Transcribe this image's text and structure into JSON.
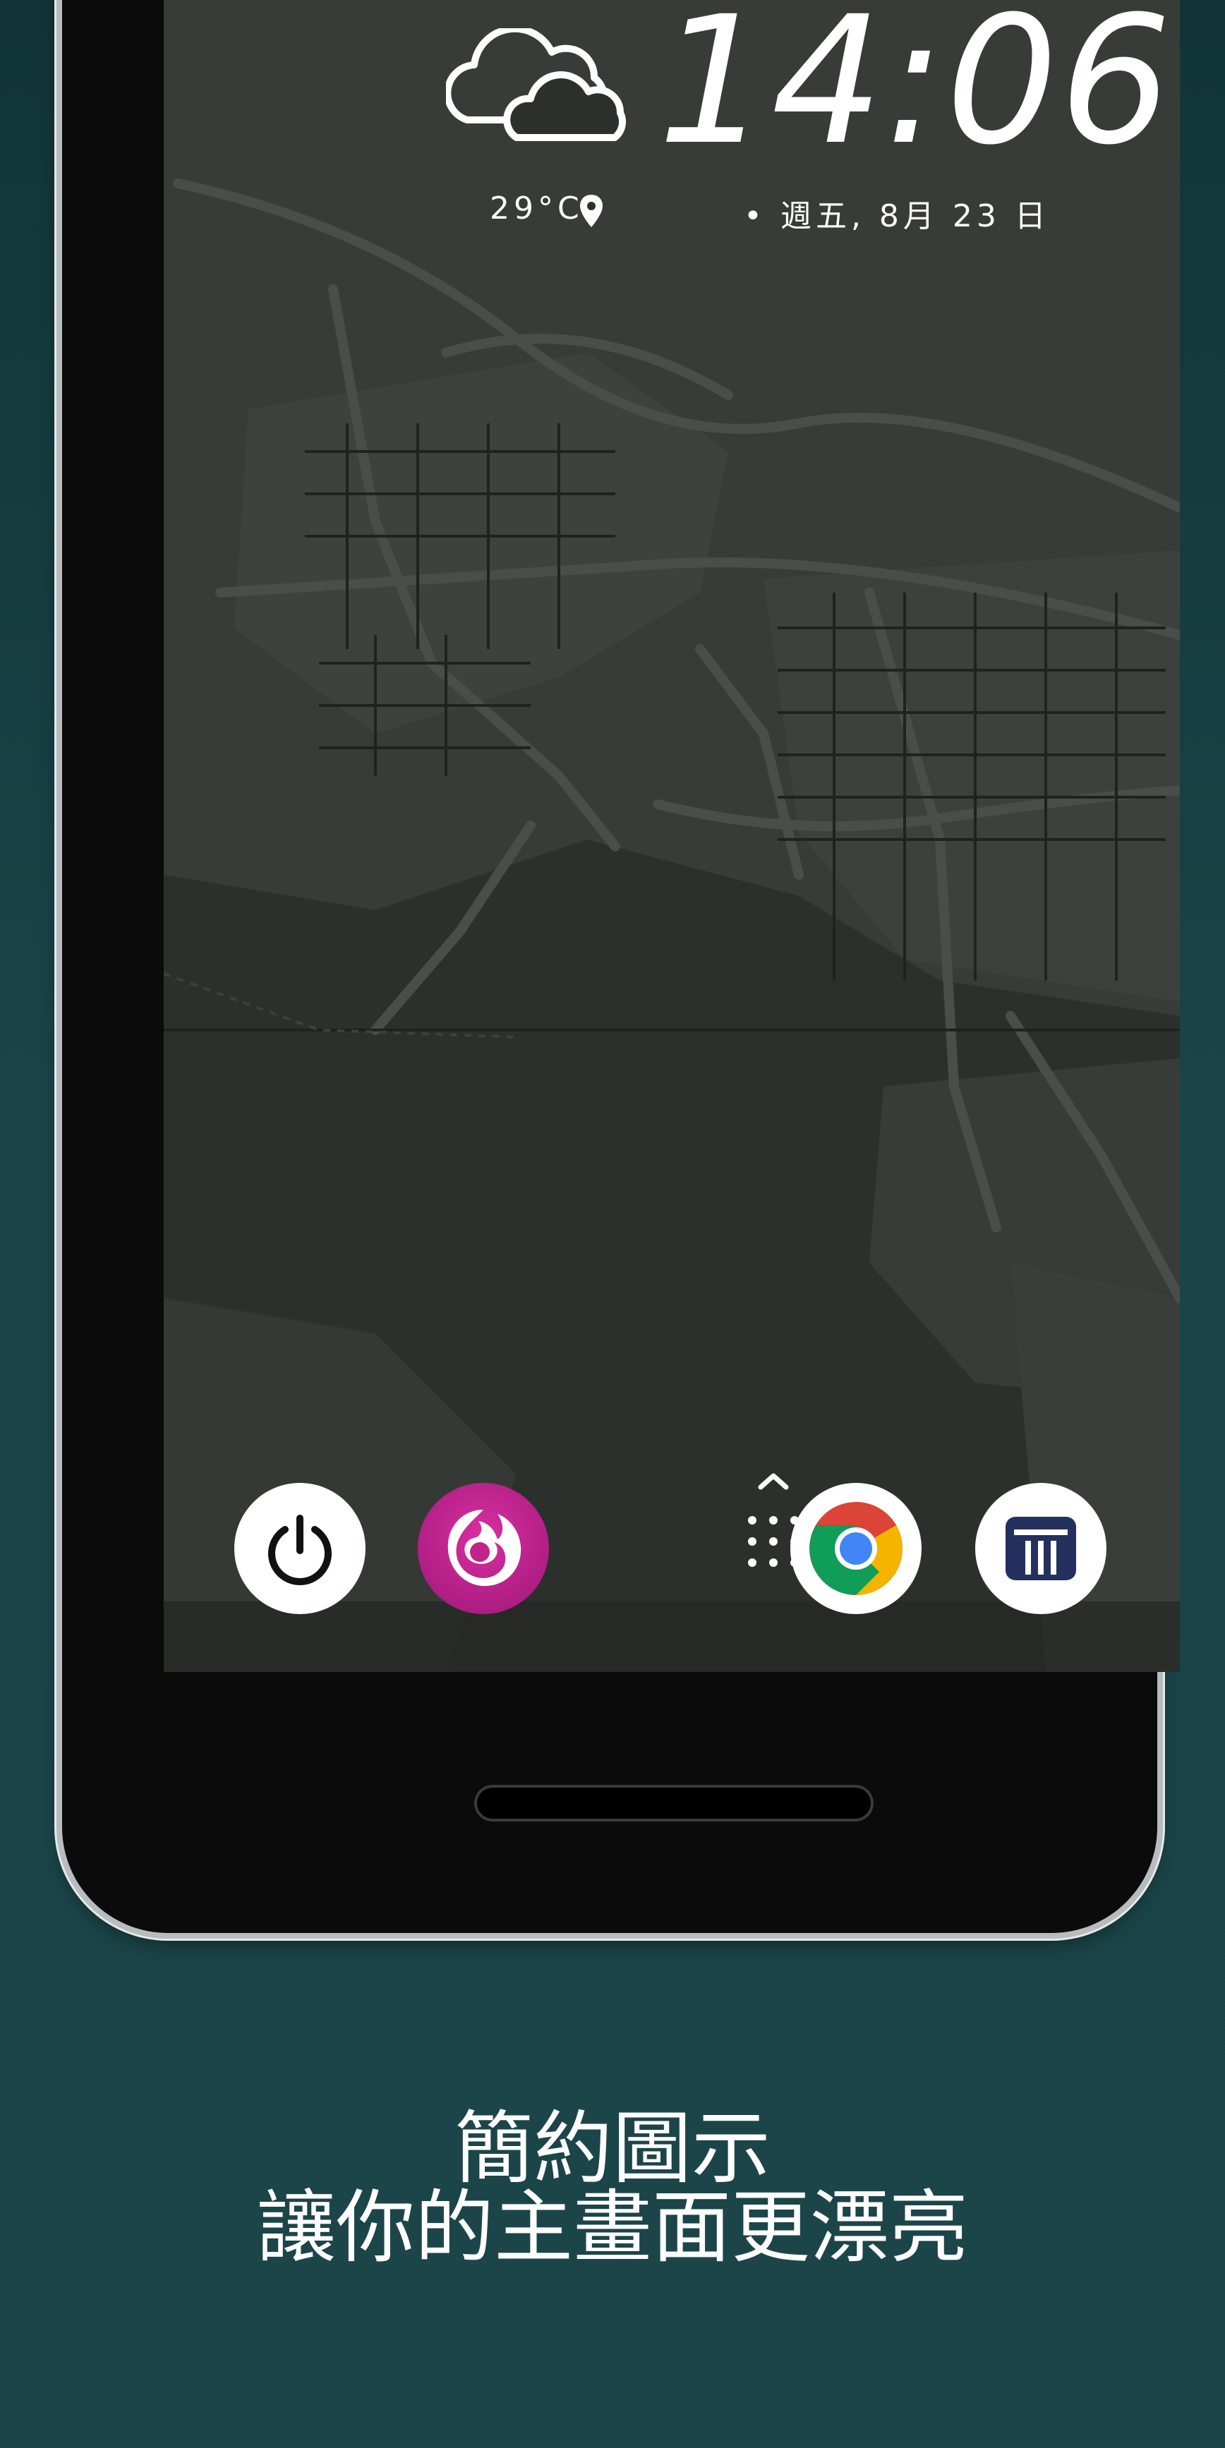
{
  "lockscreen": {
    "time": "14:06",
    "temperature": "29°C",
    "date": "• 週五, 8月 23 日",
    "weather_icon": "cloudy-icon",
    "location_icon": "location-pin-icon"
  },
  "dock": {
    "apps": [
      {
        "name": "power",
        "icon": "power-icon"
      },
      {
        "name": "firefox-focus",
        "icon": "firefox-focus-icon"
      },
      {
        "name": "app-drawer",
        "icon": "app-drawer-icon"
      },
      {
        "name": "chrome",
        "icon": "chrome-icon"
      },
      {
        "name": "news",
        "icon": "news-icon"
      }
    ]
  },
  "caption": {
    "line1": "簡約圖示",
    "line2": "讓你的主畫面更漂亮"
  },
  "colors": {
    "background": "#1a4448",
    "screen": "#2b2f2c",
    "firefox_magenta": "#c2238a",
    "news_navy": "#25305e"
  }
}
